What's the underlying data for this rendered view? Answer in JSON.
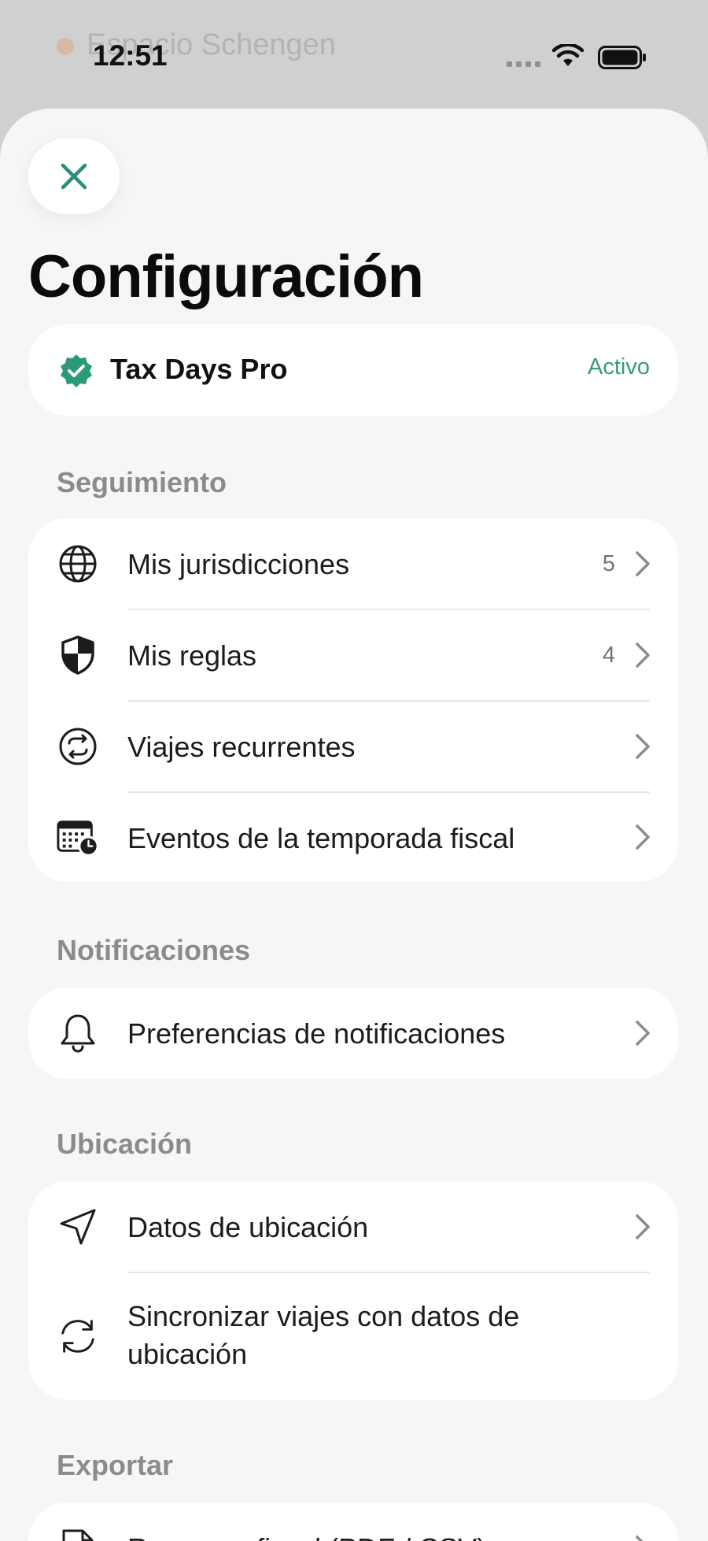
{
  "status_bar": {
    "time": "12:51"
  },
  "background_app": {
    "title": "Espacio Schengen"
  },
  "sheet": {
    "title": "Configuración",
    "close_icon": "close-icon",
    "pro": {
      "name": "Tax Days Pro",
      "status": "Activo",
      "icon": "verified-badge-icon",
      "accent_color": "#2b9a78"
    },
    "sections": {
      "seguimiento": {
        "header": "Seguimiento",
        "items": [
          {
            "label": "Mis jurisdicciones",
            "count": "5",
            "icon": "globe-icon"
          },
          {
            "label": "Mis reglas",
            "count": "4",
            "icon": "shield-icon"
          },
          {
            "label": "Viajes recurrentes",
            "count": "",
            "icon": "repeat-icon"
          },
          {
            "label": "Eventos de la temporada fiscal",
            "count": "",
            "icon": "calendar-clock-icon"
          }
        ]
      },
      "notificaciones": {
        "header": "Notificaciones",
        "items": [
          {
            "label": "Preferencias de notificaciones",
            "icon": "bell-icon"
          }
        ]
      },
      "ubicacion": {
        "header": "Ubicación",
        "items": [
          {
            "label": "Datos de ubicación",
            "icon": "location-arrow-icon"
          },
          {
            "label": "Sincronizar viajes con datos de ubicación",
            "icon": "sync-icon"
          }
        ]
      },
      "exportar": {
        "header": "Exportar",
        "items": [
          {
            "label": "Resumen fiscal (PDF / CSV)",
            "icon": "document-icon"
          }
        ]
      }
    }
  }
}
